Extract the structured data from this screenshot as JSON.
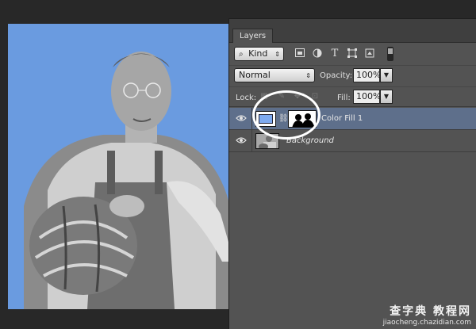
{
  "canvas": {
    "background_color": "#6a9be0"
  },
  "panel": {
    "tab_label": "Layers",
    "filter": {
      "search_icon": "search-icon",
      "kind_label": "Kind",
      "icons": [
        "image-filter-icon",
        "adjustment-filter-icon",
        "type-filter-icon",
        "shape-filter-icon",
        "smart-object-filter-icon"
      ]
    },
    "blend": {
      "mode": "Normal",
      "opacity_label": "Opacity:",
      "opacity_value": "100%"
    },
    "lock": {
      "label": "Lock:",
      "fill_label": "Fill:",
      "fill_value": "100%"
    },
    "layers": [
      {
        "name": "Color Fill 1",
        "selected": true,
        "visible": true,
        "fill_color": "#7eaaf0"
      },
      {
        "name": "Background",
        "selected": false,
        "visible": true
      }
    ],
    "selection_color": "#5e6f8b"
  },
  "watermark": {
    "main": "查字典 教程网",
    "sub": "jiaocheng.chazidian.com"
  }
}
